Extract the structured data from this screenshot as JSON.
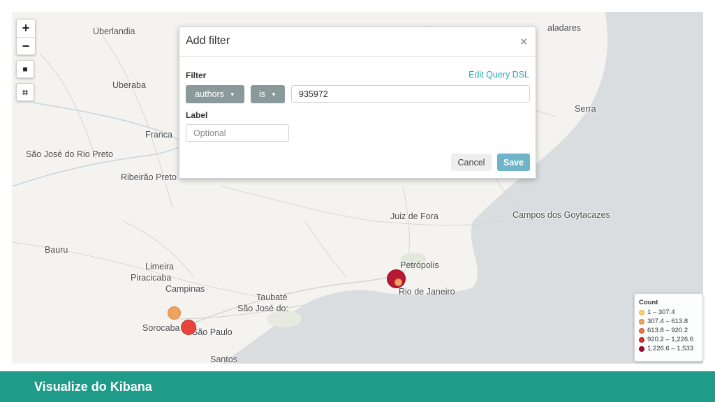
{
  "map": {
    "cities": [
      {
        "id": "uberlandia",
        "name": "Uberlandia"
      },
      {
        "id": "uberaba",
        "name": "Uberaba"
      },
      {
        "id": "franca",
        "name": "Franca"
      },
      {
        "id": "sao-jose-rio-preto",
        "name": "São José do Rio Preto"
      },
      {
        "id": "ribeirao-preto",
        "name": "Ribeirão Preto"
      },
      {
        "id": "bauru",
        "name": "Bauru"
      },
      {
        "id": "limeira",
        "name": "Limeira"
      },
      {
        "id": "piracicaba",
        "name": "Piracicaba"
      },
      {
        "id": "campinas",
        "name": "Campinas"
      },
      {
        "id": "sorocaba",
        "name": "Sorocaba"
      },
      {
        "id": "sao-paulo",
        "name": "São Paulo"
      },
      {
        "id": "santos",
        "name": "Santos"
      },
      {
        "id": "taubate",
        "name": "Taubaté"
      },
      {
        "id": "sao-jose-dos-campos",
        "name": "São José do:"
      },
      {
        "id": "juiz-de-fora",
        "name": "Juiz de Fora"
      },
      {
        "id": "petropolis",
        "name": "Petrópolis"
      },
      {
        "id": "rio-de-janeiro",
        "name": "Rio de Janeiro"
      },
      {
        "id": "campos",
        "name": "Campos dos Goytacazes"
      },
      {
        "id": "serra",
        "name": "Serra"
      },
      {
        "id": "valadares",
        "name": "aladares"
      }
    ],
    "controls": {
      "zoom_in": "+",
      "zoom_out": "−",
      "draw_rect": "■",
      "crop": "⌗"
    }
  },
  "modal": {
    "title": "Add filter",
    "close": "×",
    "filter_label": "Filter",
    "edit_dsl": "Edit Query DSL",
    "field_value": "authors",
    "operator_value": "is",
    "value": "935972",
    "label_label": "Label",
    "label_placeholder": "Optional",
    "cancel": "Cancel",
    "save": "Save"
  },
  "legend": {
    "title": "Count",
    "items": [
      {
        "range": "1 – 307.4",
        "color": "#f6d66f"
      },
      {
        "range": "307.4 – 613.8",
        "color": "#f0a35c"
      },
      {
        "range": "613.8 – 920.2",
        "color": "#e9744a"
      },
      {
        "range": "920.2 – 1,226.6",
        "color": "#d9302d"
      },
      {
        "range": "1,226.6 – 1,533",
        "color": "#a3082d"
      }
    ]
  },
  "footer": {
    "title": "Visualize do Kibana"
  }
}
